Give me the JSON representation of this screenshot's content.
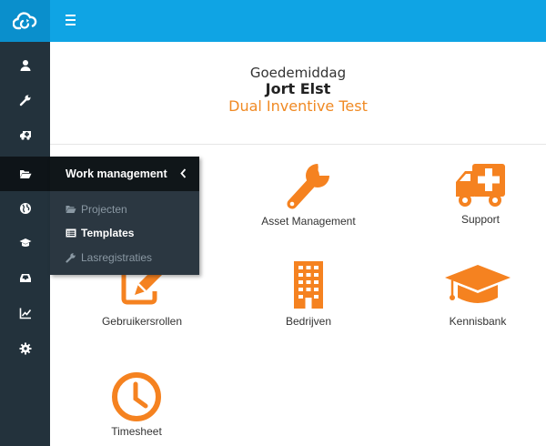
{
  "colors": {
    "accent": "#f58220",
    "topbar": "#0fa4e4",
    "sidebar": "#23323c"
  },
  "greeting": {
    "salutation": "Goedemiddag",
    "user_name": "Jort Elst",
    "organization": "Dual Inventive Test"
  },
  "sidebar": {
    "items": [
      {
        "name": "user-icon",
        "active": false
      },
      {
        "name": "wrench-icon",
        "active": false
      },
      {
        "name": "ambulance-icon",
        "active": false
      },
      {
        "name": "folder-open-icon",
        "active": true
      },
      {
        "name": "globe-icon",
        "active": false
      },
      {
        "name": "graduation-cap-icon",
        "active": false
      },
      {
        "name": "inbox-icon",
        "active": false
      },
      {
        "name": "line-chart-icon",
        "active": false
      },
      {
        "name": "gear-icon",
        "active": false
      }
    ]
  },
  "flyout": {
    "title": "Work management",
    "items": [
      {
        "label": "Projecten",
        "icon": "folder-open-icon"
      },
      {
        "label": "Templates",
        "icon": "list-alt-icon"
      },
      {
        "label": "Lasregistraties",
        "icon": "wrench-icon"
      }
    ]
  },
  "tiles": [
    {
      "label": "Asset Management",
      "icon": "wrench-icon"
    },
    {
      "label": "Support",
      "icon": "ambulance-icon"
    },
    {
      "label": "Gebruikersrollen",
      "icon": "edit-icon"
    },
    {
      "label": "Bedrijven",
      "icon": "building-icon"
    },
    {
      "label": "Kennisbank",
      "icon": "graduation-cap-icon"
    },
    {
      "label": "Timesheet",
      "icon": "clock-icon"
    }
  ]
}
